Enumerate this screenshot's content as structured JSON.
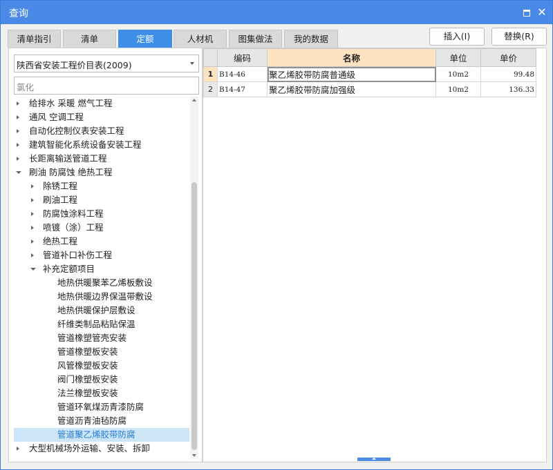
{
  "window": {
    "title": "查询"
  },
  "tabs": [
    {
      "label": "清单指引",
      "active": false
    },
    {
      "label": "清单",
      "active": false
    },
    {
      "label": "定额",
      "active": true
    },
    {
      "label": "人材机",
      "active": false
    },
    {
      "label": "图集做法",
      "active": false
    },
    {
      "label": "我的数据",
      "active": false
    }
  ],
  "actions": {
    "insert": "插入(I)",
    "replace": "替换(R)"
  },
  "library": {
    "selected": "陕西省安装工程价目表(2009)"
  },
  "search": {
    "value": "氯化"
  },
  "tree": [
    {
      "label": "给排水 采暖 燃气工程",
      "level": 0,
      "toggle": "collapsed"
    },
    {
      "label": "通风 空调工程",
      "level": 0,
      "toggle": "collapsed"
    },
    {
      "label": "自动化控制仪表安装工程",
      "level": 0,
      "toggle": "collapsed"
    },
    {
      "label": "建筑智能化系统设备安装工程",
      "level": 0,
      "toggle": "collapsed"
    },
    {
      "label": "长距离输送管道工程",
      "level": 0,
      "toggle": "collapsed"
    },
    {
      "label": "刷油 防腐蚀 绝热工程",
      "level": 0,
      "toggle": "expanded"
    },
    {
      "label": "除锈工程",
      "level": 1,
      "toggle": "collapsed"
    },
    {
      "label": "刷油工程",
      "level": 1,
      "toggle": "collapsed"
    },
    {
      "label": "防腐蚀涂料工程",
      "level": 1,
      "toggle": "collapsed"
    },
    {
      "label": "喷镀（涂）工程",
      "level": 1,
      "toggle": "collapsed"
    },
    {
      "label": "绝热工程",
      "level": 1,
      "toggle": "collapsed"
    },
    {
      "label": "管道补口补伤工程",
      "level": 1,
      "toggle": "collapsed"
    },
    {
      "label": "补充定额项目",
      "level": 1,
      "toggle": "expanded"
    },
    {
      "label": "地热供暖聚苯乙烯板敷设",
      "level": 2,
      "toggle": "none"
    },
    {
      "label": "地热供暖边界保温带敷设",
      "level": 2,
      "toggle": "none"
    },
    {
      "label": "地热供暖保护层敷设",
      "level": 2,
      "toggle": "none"
    },
    {
      "label": "纤维类制品粘贴保温",
      "level": 2,
      "toggle": "none"
    },
    {
      "label": "管道橡塑管壳安装",
      "level": 2,
      "toggle": "none"
    },
    {
      "label": "管道橡塑板安装",
      "level": 2,
      "toggle": "none"
    },
    {
      "label": "风管橡塑板安装",
      "level": 2,
      "toggle": "none"
    },
    {
      "label": "阀门橡塑板安装",
      "level": 2,
      "toggle": "none"
    },
    {
      "label": "法兰橡塑板安装",
      "level": 2,
      "toggle": "none"
    },
    {
      "label": "管道环氧煤沥青漆防腐",
      "level": 2,
      "toggle": "none"
    },
    {
      "label": "管道沥青油毡防腐",
      "level": 2,
      "toggle": "none"
    },
    {
      "label": "管道聚乙烯胶带防腐",
      "level": 2,
      "toggle": "none",
      "selected": true
    },
    {
      "label": "大型机械场外运输、安装、拆卸",
      "level": 0,
      "toggle": "collapsed"
    }
  ],
  "grid": {
    "headers": {
      "code": "编码",
      "name": "名称",
      "unit": "单位",
      "price": "单价"
    },
    "rows": [
      {
        "no": "1",
        "code": "B14-46",
        "name": "聚乙烯胶带防腐普通级",
        "unit": "10m2",
        "price": "99.48"
      },
      {
        "no": "2",
        "code": "B14-47",
        "name": "聚乙烯胶带防腐加强级",
        "unit": "10m2",
        "price": "136.33"
      }
    ]
  }
}
